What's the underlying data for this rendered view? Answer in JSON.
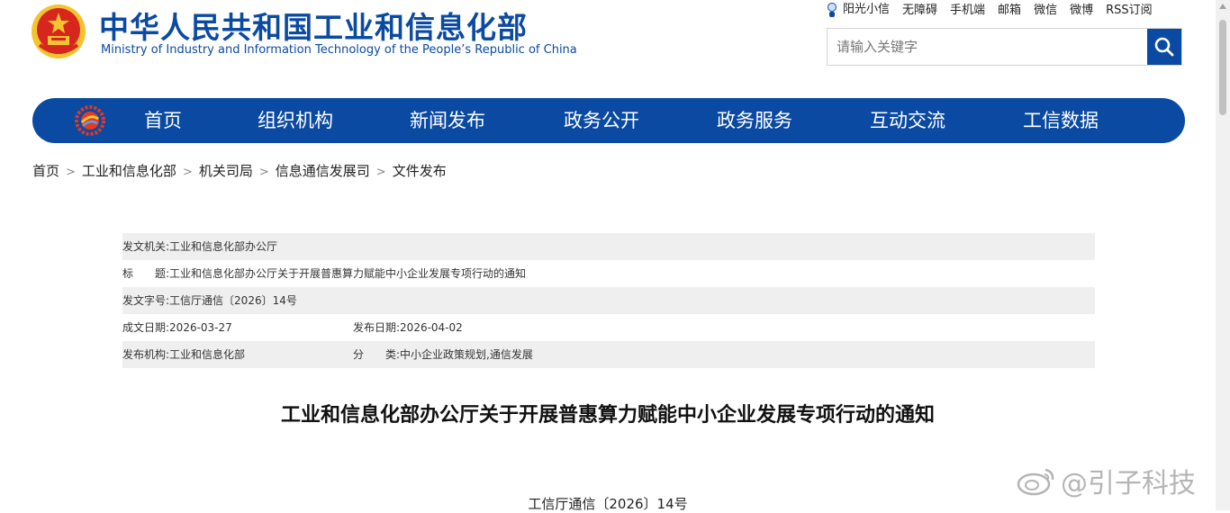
{
  "header": {
    "title_cn": "中华人民共和国工业和信息化部",
    "title_en": "Ministry of Industry and Information Technology of the People’s Republic of China"
  },
  "top_links": [
    "阳光小信",
    "无障碍",
    "手机端",
    "邮箱",
    "微信",
    "微博",
    "RSS订阅"
  ],
  "search": {
    "placeholder": "请输入关键字"
  },
  "nav": {
    "items": [
      "首页",
      "组织机构",
      "新闻发布",
      "政务公开",
      "政务服务",
      "互动交流",
      "工信数据"
    ]
  },
  "breadcrumb": [
    "首页",
    "工业和信息化部",
    "机关司局",
    "信息通信发展司",
    "文件发布"
  ],
  "info": {
    "issuer_label": "发文机关:",
    "issuer": "工业和信息化部办公厅",
    "title_label": "标　　题:",
    "title": "工业和信息化部办公厅关于开展普惠算力赋能中小企业发展专项行动的通知",
    "docno_label": "发文字号:",
    "docno": "工信厅通信〔2026〕14号",
    "created_label": "成文日期:",
    "created": "2026-03-27",
    "published_label": "发布日期:",
    "published": "2026-04-02",
    "org_label": "发布机构:",
    "org": "工业和信息化部",
    "category_label": "分　　类:",
    "category": "中小企业政策规划,通信发展"
  },
  "article": {
    "title": "工业和信息化部办公厅关于开展普惠算力赋能中小企业发展专项行动的通知",
    "doc_number": "工信厅通信〔2026〕14号"
  },
  "watermark": {
    "text": "@引子科技"
  },
  "colors": {
    "brand_blue": "#0b4aa2",
    "row_shade": "#efefef",
    "emblem_red": "#d7261e",
    "emblem_gold": "#f4c430"
  }
}
